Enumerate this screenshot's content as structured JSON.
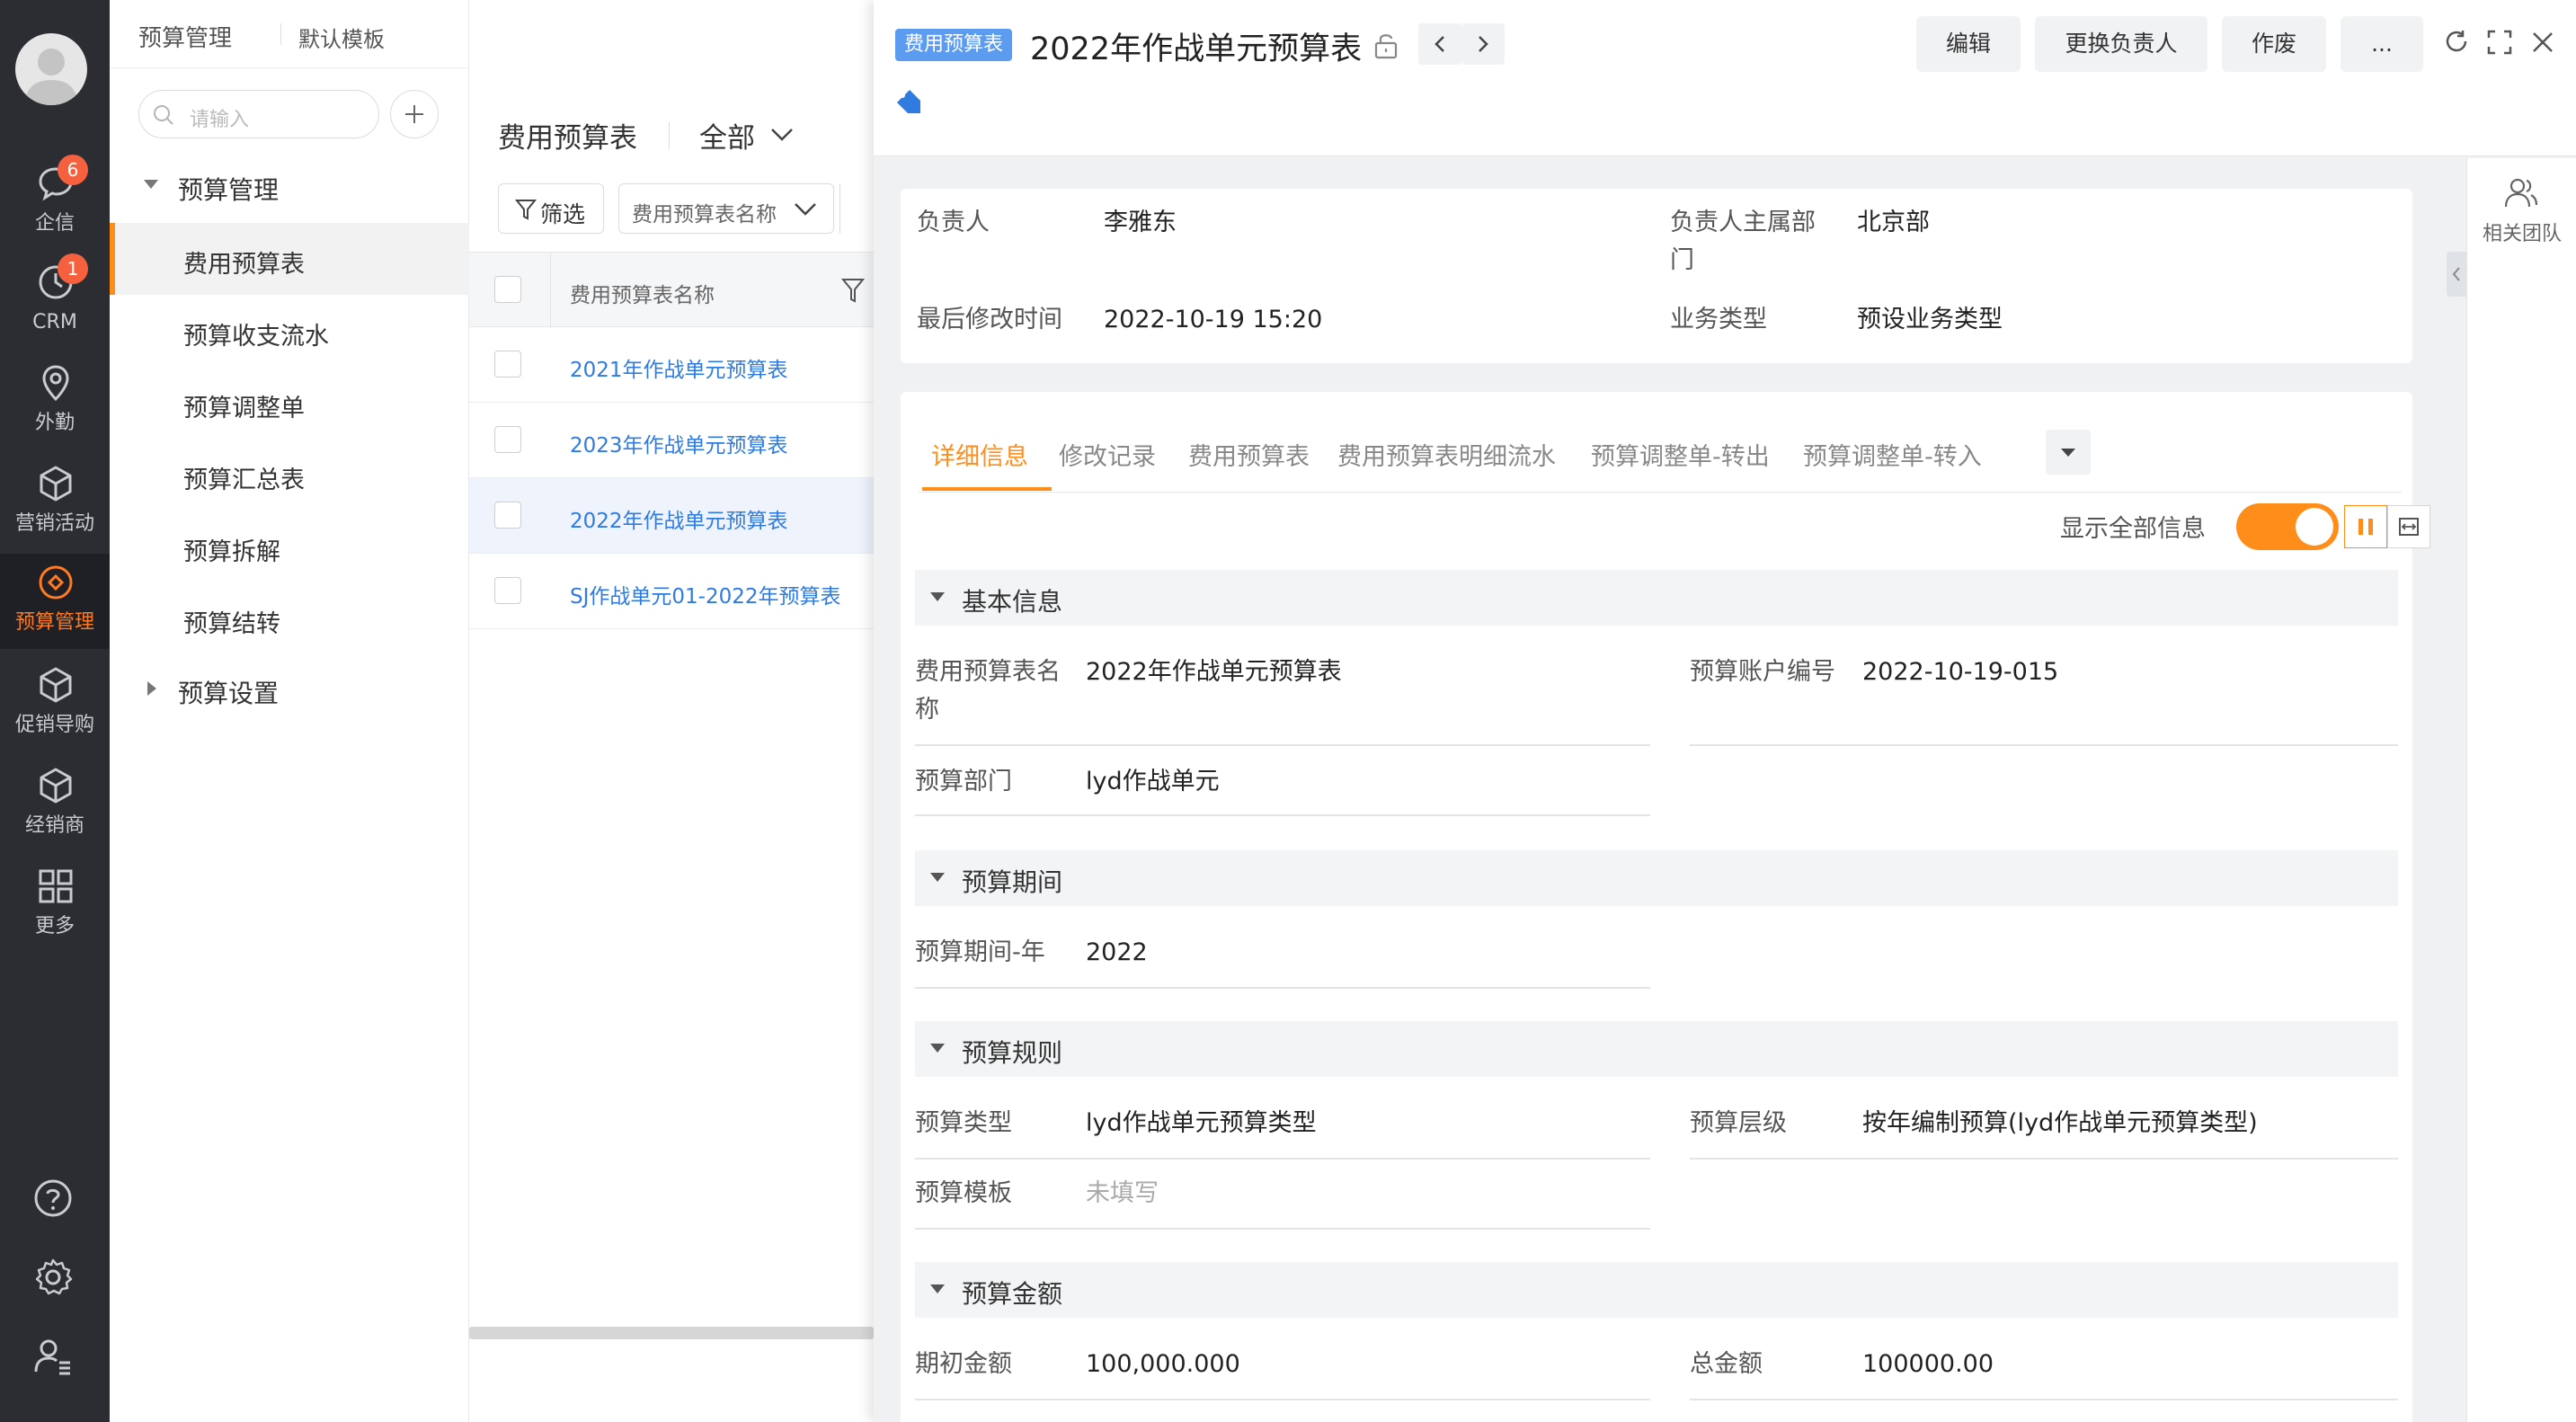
{
  "rail": {
    "items": [
      {
        "label": "企信",
        "badge": "6",
        "icon": "chat-bubble-icon"
      },
      {
        "label": "CRM",
        "badge": "1",
        "icon": "clock-icon"
      },
      {
        "label": "外勤",
        "icon": "location-pin-icon"
      },
      {
        "label": "营销活动",
        "icon": "cube-icon"
      },
      {
        "label": "预算管理",
        "icon": "budget-icon"
      },
      {
        "label": "促销导购",
        "icon": "cube-icon"
      },
      {
        "label": "经销商",
        "icon": "cube-icon"
      },
      {
        "label": "更多",
        "icon": "grid-icon"
      }
    ],
    "active_color": "#ff7a22"
  },
  "nav": {
    "module_title": "预算管理",
    "template_label": "默认模板",
    "search_placeholder": "请输入",
    "group1": "预算管理",
    "items": [
      "费用预算表",
      "预算收支流水",
      "预算调整单",
      "预算汇总表",
      "预算拆解",
      "预算结转"
    ],
    "group2": "预算设置"
  },
  "list": {
    "title": "费用预算表",
    "scope": "全部",
    "filter_label": "筛选",
    "field_select": "费用预算表名称",
    "column_header": "费用预算表名称",
    "rows": [
      "2021年作战单元预算表",
      "2023年作战单元预算表",
      "2022年作战单元预算表",
      "SJ作战单元01-2022年预算表"
    ]
  },
  "detail": {
    "object_tag": "费用预算表",
    "title": "2022年作战单元预算表",
    "actions": {
      "edit": "编辑",
      "change_owner": "更换负责人",
      "void": "作废",
      "more": "..."
    },
    "summary": {
      "owner_label": "负责人",
      "owner": "李雅东",
      "dept_label_1": "负责人主属部",
      "dept_label_2": "门",
      "dept": "北京部",
      "modified_label": "最后修改时间",
      "modified": "2022-10-19 15:20",
      "biz_label": "业务类型",
      "biz": "预设业务类型"
    },
    "related_team": "相关团队",
    "tabs": [
      "详细信息",
      "修改记录",
      "费用预算表",
      "费用预算表明细流水",
      "预算调整单-转出",
      "预算调整单-转入"
    ],
    "show_all": "显示全部信息",
    "sections": {
      "basic": {
        "title": "基本信息",
        "name_label_1": "费用预算表名",
        "name_label_2": "称",
        "name": "2022年作战单元预算表",
        "acct_label": "预算账户编号",
        "acct": "2022-10-19-015",
        "dept_label": "预算部门",
        "dept": "lyd作战单元"
      },
      "period": {
        "title": "预算期间",
        "year_label": "预算期间-年",
        "year": "2022"
      },
      "rule": {
        "title": "预算规则",
        "type_label": "预算类型",
        "type": "lyd作战单元预算类型",
        "level_label": "预算层级",
        "level": "按年编制预算(lyd作战单元预算类型)",
        "tpl_label": "预算模板",
        "tpl": "未填写"
      },
      "amount": {
        "title": "预算金额",
        "initial_label": "期初金额",
        "initial": "100,000.000",
        "total_label": "总金额",
        "total": "100000.00"
      }
    },
    "accent": "#ff8d1a",
    "link_color": "#2f7be0"
  }
}
